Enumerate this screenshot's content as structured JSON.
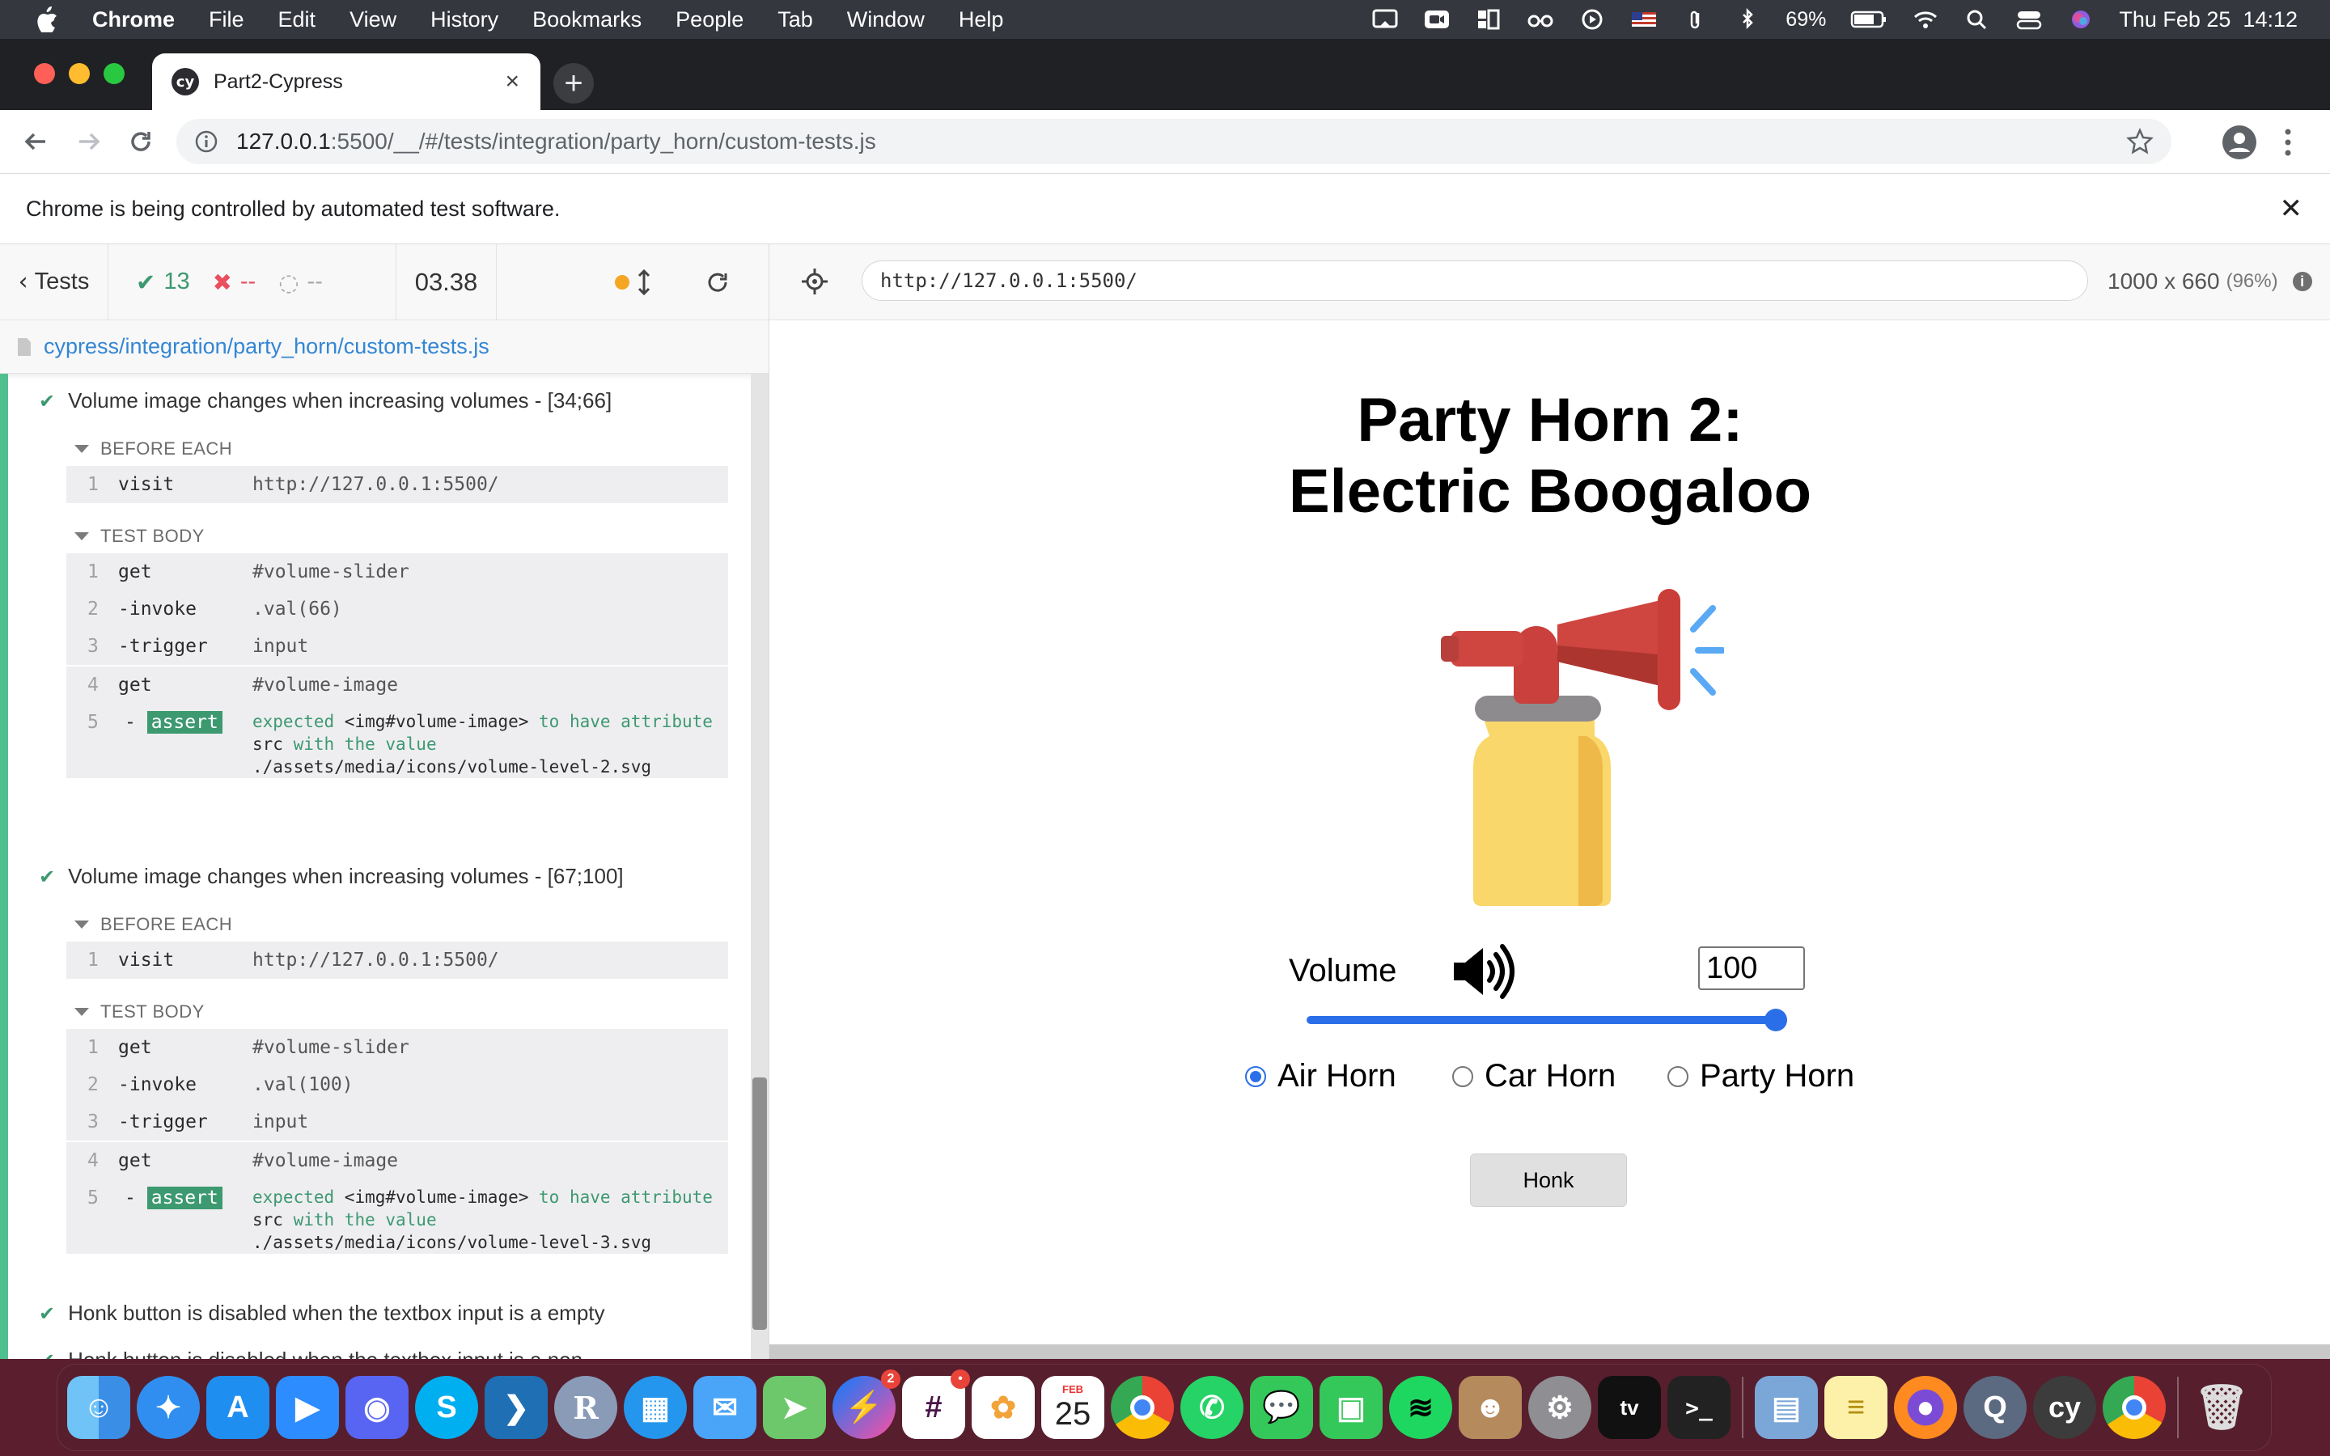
{
  "menubar": {
    "app": "Chrome",
    "items": [
      "File",
      "Edit",
      "View",
      "History",
      "Bookmarks",
      "People",
      "Tab",
      "Window",
      "Help"
    ],
    "battery": "69%",
    "datetime": "Thu Feb 25  14:12"
  },
  "browser": {
    "tab_title": "Part2-Cypress",
    "favicon_text": "cy",
    "url_host": "127.0.0.1",
    "url_path": ":5500/__/#/tests/integration/party_horn/custom-tests.js",
    "automation_notice": "Chrome is being controlled by automated test software."
  },
  "reporter": {
    "back_label": "Tests",
    "passed": "13",
    "failed": "--",
    "pending": "--",
    "duration": "03.38",
    "spec_path": "cypress/integration/party_horn/custom-tests.js",
    "tests": [
      {
        "title": "Volume image changes when increasing volumes - [34;66]",
        "before_each_label": "BEFORE EACH",
        "before_each": [
          {
            "num": "1",
            "name": "visit",
            "msg": "http://127.0.0.1:5500/"
          }
        ],
        "test_body_label": "TEST BODY",
        "body": [
          {
            "num": "1",
            "name": "get",
            "msg": "#volume-slider"
          },
          {
            "num": "2",
            "name": "-invoke",
            "msg": ".val(66)"
          },
          {
            "num": "3",
            "name": "-trigger",
            "msg": "input"
          },
          {
            "num": "4",
            "name": "get",
            "msg": "#volume-image"
          }
        ],
        "assert": {
          "num": "5",
          "dash": "-",
          "label": "assert",
          "line1_a": "expected ",
          "line1_b": "<img#volume-image>",
          "line1_c": " to have attribute",
          "line2_a": "src",
          "line2_b": " with the value",
          "line3": "./assets/media/icons/volume-level-2.svg"
        }
      },
      {
        "title": "Volume image changes when increasing volumes - [67;100]",
        "before_each_label": "BEFORE EACH",
        "before_each": [
          {
            "num": "1",
            "name": "visit",
            "msg": "http://127.0.0.1:5500/"
          }
        ],
        "test_body_label": "TEST BODY",
        "body": [
          {
            "num": "1",
            "name": "get",
            "msg": "#volume-slider"
          },
          {
            "num": "2",
            "name": "-invoke",
            "msg": ".val(100)"
          },
          {
            "num": "3",
            "name": "-trigger",
            "msg": "input"
          },
          {
            "num": "4",
            "name": "get",
            "msg": "#volume-image"
          }
        ],
        "assert": {
          "num": "5",
          "dash": "-",
          "label": "assert",
          "line1_a": "expected ",
          "line1_b": "<img#volume-image>",
          "line1_c": " to have attribute",
          "line2_a": "src",
          "line2_b": " with the value",
          "line3": "./assets/media/icons/volume-level-3.svg"
        }
      },
      {
        "title": "Honk button is disabled when the textbox input is a empty"
      },
      {
        "title": "Honk button is disabled when the textbox input is a non-"
      }
    ]
  },
  "aut": {
    "url": "http://127.0.0.1:5500/",
    "viewport": "1000 x 660",
    "scale": "(96%)",
    "title_line1": "Party Horn 2:",
    "title_line2": "Electric Boogaloo",
    "volume_label": "Volume",
    "volume_value": "100",
    "volume_slider_fraction": 1.0,
    "radios": [
      "Air Horn",
      "Car Horn",
      "Party Horn"
    ],
    "selected_radio": "Air Horn",
    "honk_label": "Honk"
  },
  "dock": {
    "calendar_month": "FEB",
    "calendar_day": "25",
    "messenger_badge": "2",
    "slack_badge": "•",
    "r_label": "R",
    "s_label": "S",
    "cy_label": "cy",
    "tv_label": "tv"
  }
}
